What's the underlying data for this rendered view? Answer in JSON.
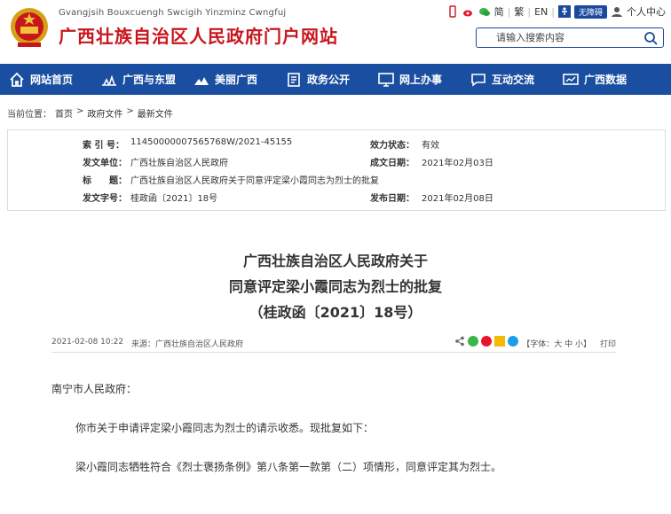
{
  "header": {
    "site_name_en": "Gvangjsih Bouxcuengh Swcigih Yinzminz Cwngfuj",
    "site_name_cn": "广西壮族自治区人民政府门户网站",
    "lang_simplified": "简",
    "lang_traditional": "繁",
    "lang_en": "EN",
    "accessibility_label": "无障碍",
    "personal_center": "个人中心",
    "search_placeholder": "请输入搜索内容"
  },
  "nav": {
    "items": [
      {
        "label": "网站首页",
        "icon": "home-icon"
      },
      {
        "label": "广西与东盟",
        "icon": "asean-icon"
      },
      {
        "label": "美丽广西",
        "icon": "landscape-icon"
      },
      {
        "label": "政务公开",
        "icon": "document-icon"
      },
      {
        "label": "网上办事",
        "icon": "monitor-icon"
      },
      {
        "label": "互动交流",
        "icon": "chat-icon"
      },
      {
        "label": "广西数据",
        "icon": "data-icon"
      }
    ]
  },
  "breadcrumb": {
    "prefix": "当前位置：",
    "items": [
      "首页",
      "政府文件",
      "最新文件"
    ],
    "separator": ">"
  },
  "meta": {
    "index_label": "索 引 号：",
    "index_value": "11450000007565768W/2021-45155",
    "validity_label": "效力状态：",
    "validity_value": "有效",
    "issuer_label": "发文单位：",
    "issuer_value": "广西壮族自治区人民政府",
    "created_label": "成文日期：",
    "created_value": "2021年02月03日",
    "title_label": "标　　题：",
    "title_value": "广西壮族自治区人民政府关于同意评定梁小霞同志为烈士的批复",
    "docnum_label": "发文字号：",
    "docnum_value": "桂政函〔2021〕18号",
    "published_label": "发布日期：",
    "published_value": "2021年02月08日"
  },
  "article": {
    "title_line1": "广西壮族自治区人民政府关于",
    "title_line2": "同意评定梁小霞同志为烈士的批复",
    "title_line3": "（桂政函〔2021〕18号）",
    "date": "2021-02-08 10:22",
    "source": "来源：广西壮族自治区人民政府",
    "font_size_label": "【字体：大 中 小】",
    "print_label": "打印",
    "salutation": "南宁市人民政府：",
    "para1": "你市关于申请评定梁小霞同志为烈士的请示收悉。现批复如下：",
    "para2": "梁小霞同志牺牲符合《烈士褒扬条例》第八条第一款第（二）项情形，同意评定其为烈士。"
  },
  "colors": {
    "brand_red": "#c8161d",
    "nav_blue": "#1a4ea0"
  }
}
